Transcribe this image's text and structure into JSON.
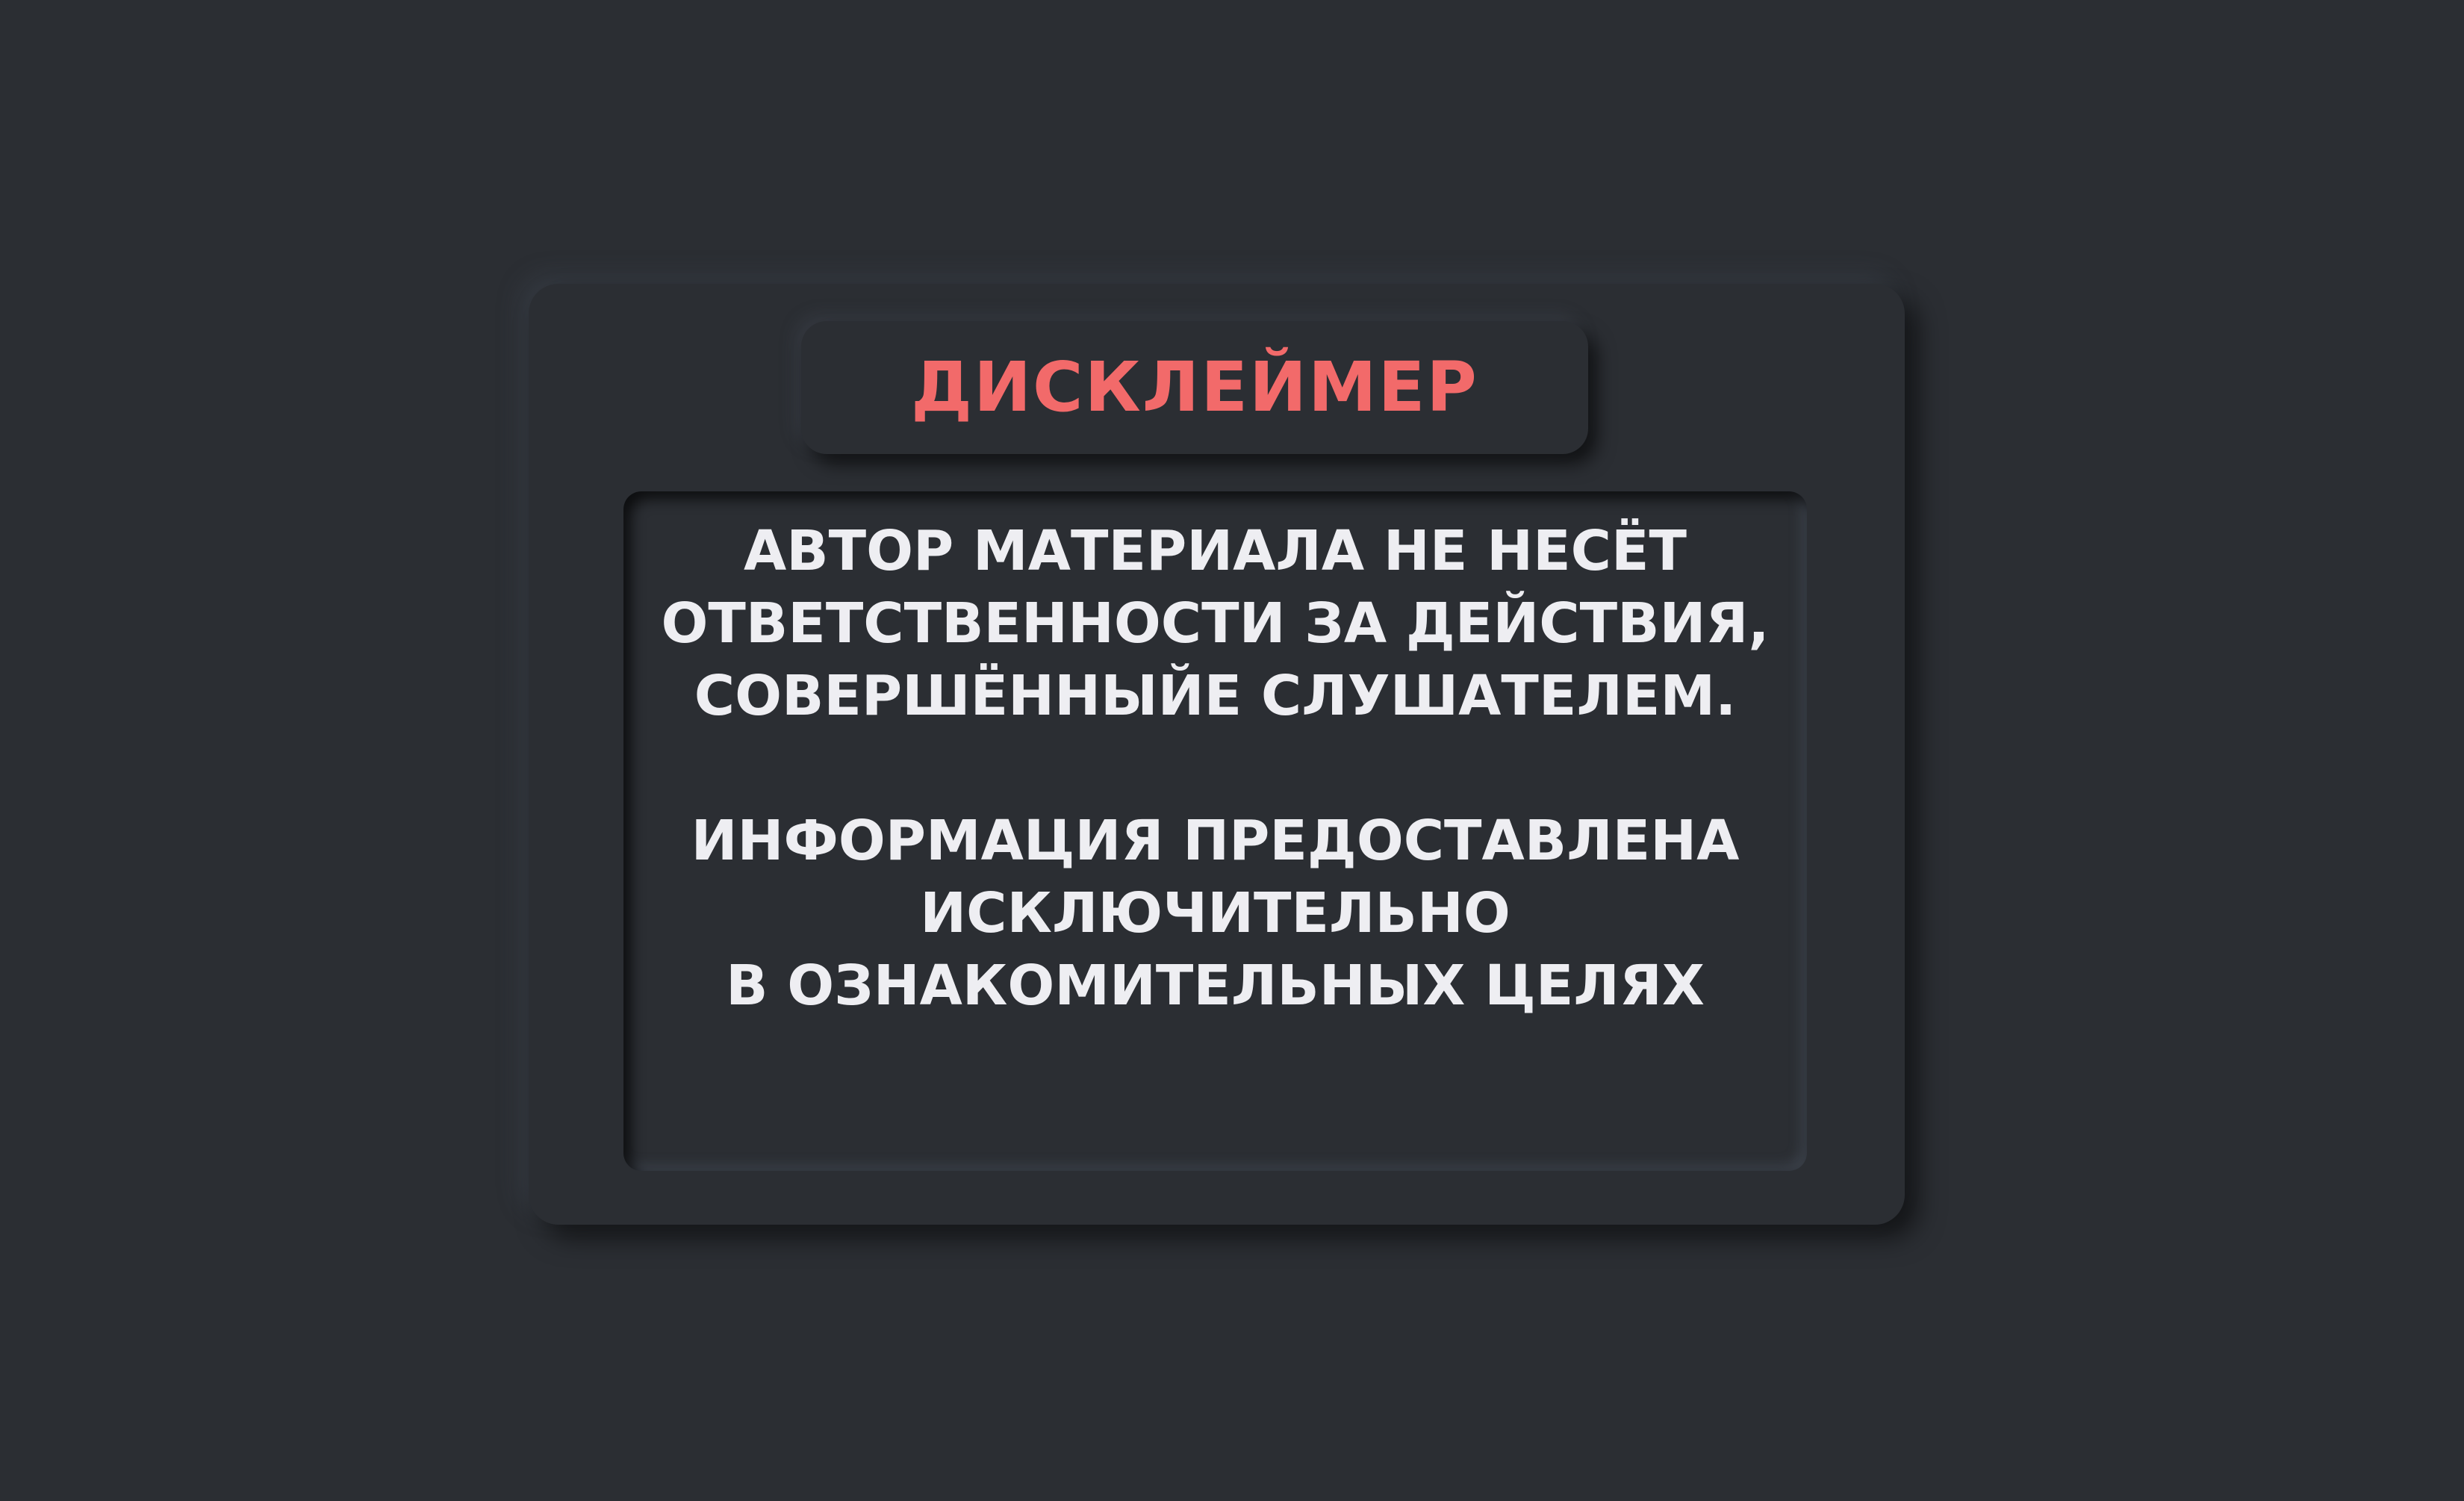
{
  "disclaimer": {
    "title": "ДИСКЛЕЙМЕР",
    "paragraphs": [
      {
        "lines": [
          "АВТОР МАТЕРИАЛА НЕ НЕСЁТ",
          "ОТВЕТСТВЕННОСТИ ЗА ДЕЙСТВИЯ,",
          "СОВЕРШЁННЫЙЕ СЛУШАТЕЛЕМ."
        ]
      },
      {
        "lines": [
          "ИНФОРМАЦИЯ ПРЕДОСТАВЛЕНА",
          "ИСКЛЮЧИТЕЛЬНО",
          "В ОЗНАКОМИТЕЛЬНЫХ ЦЕЛЯХ"
        ]
      }
    ]
  },
  "colors": {
    "background": "#2b2e33",
    "title": "#f26a6a",
    "text": "#eeeef2"
  }
}
